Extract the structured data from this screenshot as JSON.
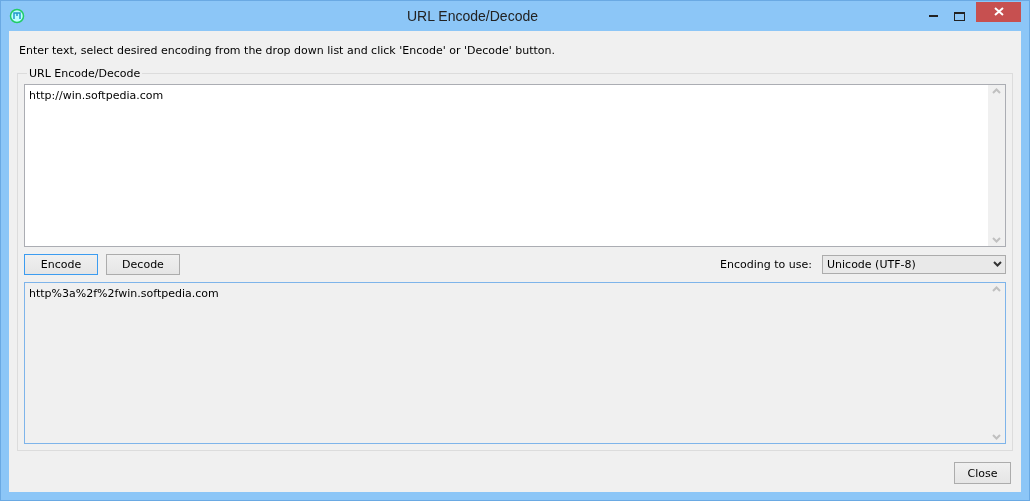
{
  "window": {
    "title": "URL Encode/Decode"
  },
  "instruction": "Enter text, select desired encoding from the drop down list and click 'Encode' or 'Decode' button.",
  "group": {
    "title": "URL Encode/Decode"
  },
  "input": {
    "value": "http://win.softpedia.com",
    "readonly": false
  },
  "buttons": [
    {
      "label": "Encode",
      "focused": true
    },
    {
      "label": "Decode",
      "focused": false
    }
  ],
  "encoding": {
    "label": "Encoding to use:",
    "value": "Unicode (UTF-8)"
  },
  "output": {
    "value": "http%3a%2f%2fwin.softpedia.com",
    "readonly": true
  },
  "close_button": {
    "label": "Close"
  }
}
